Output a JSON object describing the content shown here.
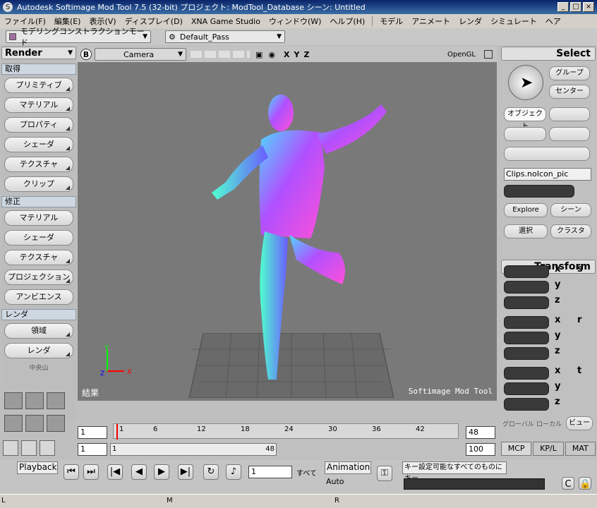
{
  "window": {
    "title": "Autodesk Softimage Mod Tool 7.5 (32-bit)    プロジェクト: ModTool_Database    シーン: Untitled"
  },
  "menubar": {
    "items": [
      "ファイル(F)",
      "編集(E)",
      "表示(V)",
      "ディスプレイ(D)",
      "XNA Game Studio",
      "ウィンドウ(W)",
      "ヘルプ(H)"
    ],
    "items2": [
      "モデル",
      "アニメート",
      "レンダ",
      "シミュレート",
      "ヘア"
    ]
  },
  "toolrow": {
    "mode": "モデリングコンストラクションモード",
    "pass": "Default_Pass"
  },
  "leftpanel": {
    "header": "Render",
    "sections": [
      {
        "title": "取得",
        "buttons": [
          "プリミティブ",
          "マテリアル",
          "プロパティ",
          "シェーダ",
          "テクスチャ",
          "クリップ"
        ]
      },
      {
        "title": "修正",
        "buttons": [
          "マテリアル",
          "シェーダ",
          "テクスチャ",
          "プロジェクション",
          "アンビエンス"
        ]
      },
      {
        "title": "レンダ",
        "buttons": [
          "領域",
          "レンダ"
        ]
      }
    ],
    "small_label": "中央山"
  },
  "viewport": {
    "letter": "B",
    "camera": "Camera",
    "axes": [
      "X",
      "Y",
      "Z"
    ],
    "renderer": "OpenGL",
    "label_left": "結果",
    "label_right": "Softimage Mod Tool"
  },
  "rightpanel": {
    "select_header": "Select",
    "group": "グループ",
    "center": "センター",
    "object": "オブジェクト",
    "clip_name": "Clips.noIcon_pic",
    "explore": "Explore",
    "scene": "シーン",
    "selection": "選択",
    "cluster": "クラスタ",
    "transform_header": "Transform",
    "axes": [
      "x",
      "y",
      "z"
    ],
    "global": "グローバル",
    "local": "ローカル",
    "view": "ビュー",
    "tabs": [
      "MCP",
      "KP/L",
      "MAT"
    ]
  },
  "timeline": {
    "start": "1",
    "end": "48",
    "current": "1",
    "range_start": "1",
    "range_end": "48",
    "max": "100",
    "ticks": [
      "1",
      "6",
      "12",
      "18",
      "24",
      "30",
      "36",
      "42"
    ],
    "slider_left": "1",
    "slider_right": "48"
  },
  "playback": {
    "label": "Playback",
    "all": "すべて",
    "animation": "Animation",
    "auto": "Auto",
    "key_label": "キー設定可能なすべてのものにキー",
    "frame": "1"
  },
  "status": {
    "m": "M",
    "r": "R",
    "l": "L"
  }
}
